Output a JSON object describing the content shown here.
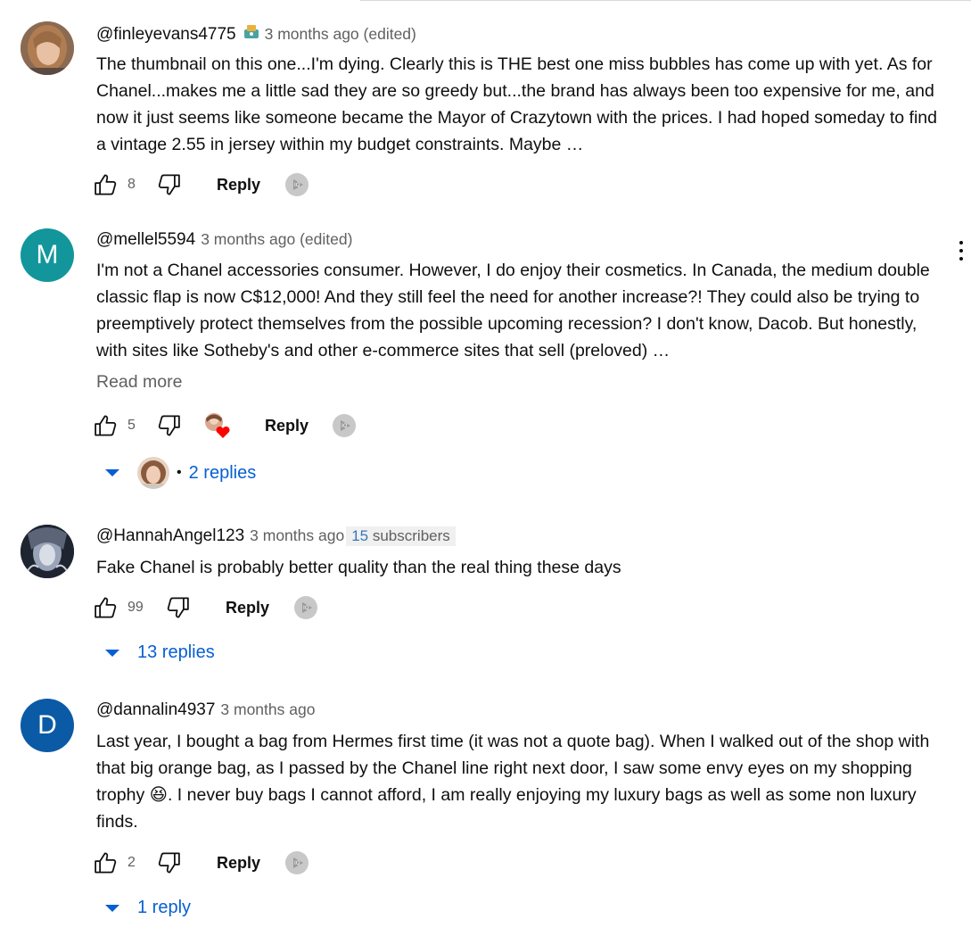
{
  "comments": [
    {
      "handle": "@finleyevans4775",
      "time": "3 months ago (edited)",
      "text": "The thumbnail on this one...I'm dying. Clearly this is THE best one miss bubbles has come up with yet. As for Chanel...makes me a little sad they are so greedy but...the brand has always been too expensive for me, and now it just seems like someone became the Mayor of Crazytown with the prices. I had hoped someday to find a vintage 2.55 in jersey within my budget constraints. Maybe …",
      "likes": "8",
      "reply_label": "Reply",
      "avatar_icon": "user-photo"
    },
    {
      "handle": "@mellel5594",
      "time": "3 months ago (edited)",
      "text": "I'm not a Chanel accessories consumer. However, I do enjoy their cosmetics. In Canada, the medium double classic flap is now C$12,000! And they still feel the need for another increase?! They could also be trying to preemptively protect themselves from the possible upcoming recession? I don't know, Dacob. But honestly, with sites like Sotheby's and other e-commerce sites that sell (preloved) …",
      "read_more": "Read more",
      "likes": "5",
      "reply_label": "Reply",
      "avatar_letter": "M",
      "avatar_color": "#12969c",
      "replies": "2 replies",
      "replies_separator": "•"
    },
    {
      "handle": "@HannahAngel123",
      "time": "3 months ago",
      "subscribers_count": "15",
      "subscribers_label": "subscribers",
      "text": "Fake Chanel is probably better quality than the real thing these days",
      "likes": "99",
      "reply_label": "Reply",
      "replies": "13 replies"
    },
    {
      "handle": "@dannalin4937",
      "time": "3 months ago",
      "text_before_emoji": "Last year, I bought a bag from Hermes first time (it was not a quote bag). When I walked out of the shop with that big orange bag, as I passed by the Chanel line right next door, I saw some envy eyes on my shopping trophy ",
      "emoji": "😆",
      "text_after_emoji": ". I never buy bags I cannot afford, I am really enjoying my luxury bags as well as some non luxury finds.",
      "likes": "2",
      "reply_label": "Reply",
      "avatar_letter": "D",
      "avatar_color": "#0b5aa6",
      "replies": "1 reply"
    }
  ],
  "colors": {
    "link_blue": "#065fd4",
    "muted_text": "#606060"
  }
}
